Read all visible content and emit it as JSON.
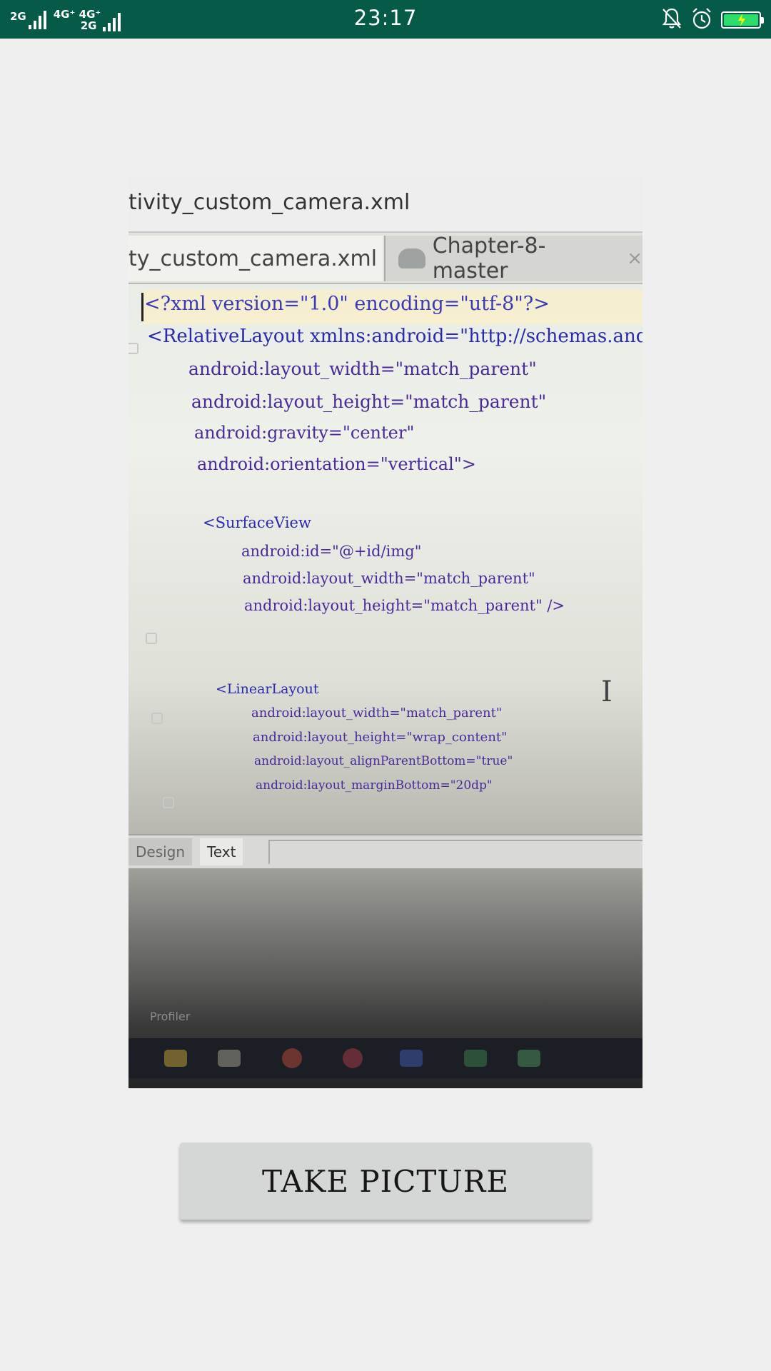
{
  "status_bar": {
    "sim1_network": "2G",
    "sim2_network_top": "4G⁺ 4G⁺",
    "sim2_network_bottom": "2G",
    "time": "23:17",
    "battery_color": "#2ddc6a",
    "icons": [
      "signal-icon",
      "bell-muted-icon",
      "alarm-icon",
      "battery-charging-icon"
    ]
  },
  "preview": {
    "window_title": "tivity_custom_camera.xml",
    "tab_active": "ty_custom_camera.xml",
    "tab_active_close": "×",
    "tab_second": "Chapter-8-master",
    "tab_second_close": "×",
    "code": [
      "<?xml version=\"1.0\" encoding=\"utf-8\"?>",
      "<RelativeLayout xmlns:android=\"http://schemas.andr",
      "android:layout_width=\"match_parent\"",
      "android:layout_height=\"match_parent\"",
      "android:gravity=\"center\"",
      "android:orientation=\"vertical\">",
      "<SurfaceView",
      "android:id=\"@+id/img\"",
      "android:layout_width=\"match_parent\"",
      "android:layout_height=\"match_parent\" />",
      "<LinearLayout",
      "android:layout_width=\"match_parent\"",
      "android:layout_height=\"wrap_content\"",
      "android:layout_alignParentBottom=\"true\"",
      "android:layout_marginBottom=\"20dp\""
    ],
    "bottom_tab_design": "Design",
    "bottom_tab_text": "Text",
    "profiler_label": "Profiler"
  },
  "take_picture_button": {
    "label": "TAKE PICTURE"
  }
}
